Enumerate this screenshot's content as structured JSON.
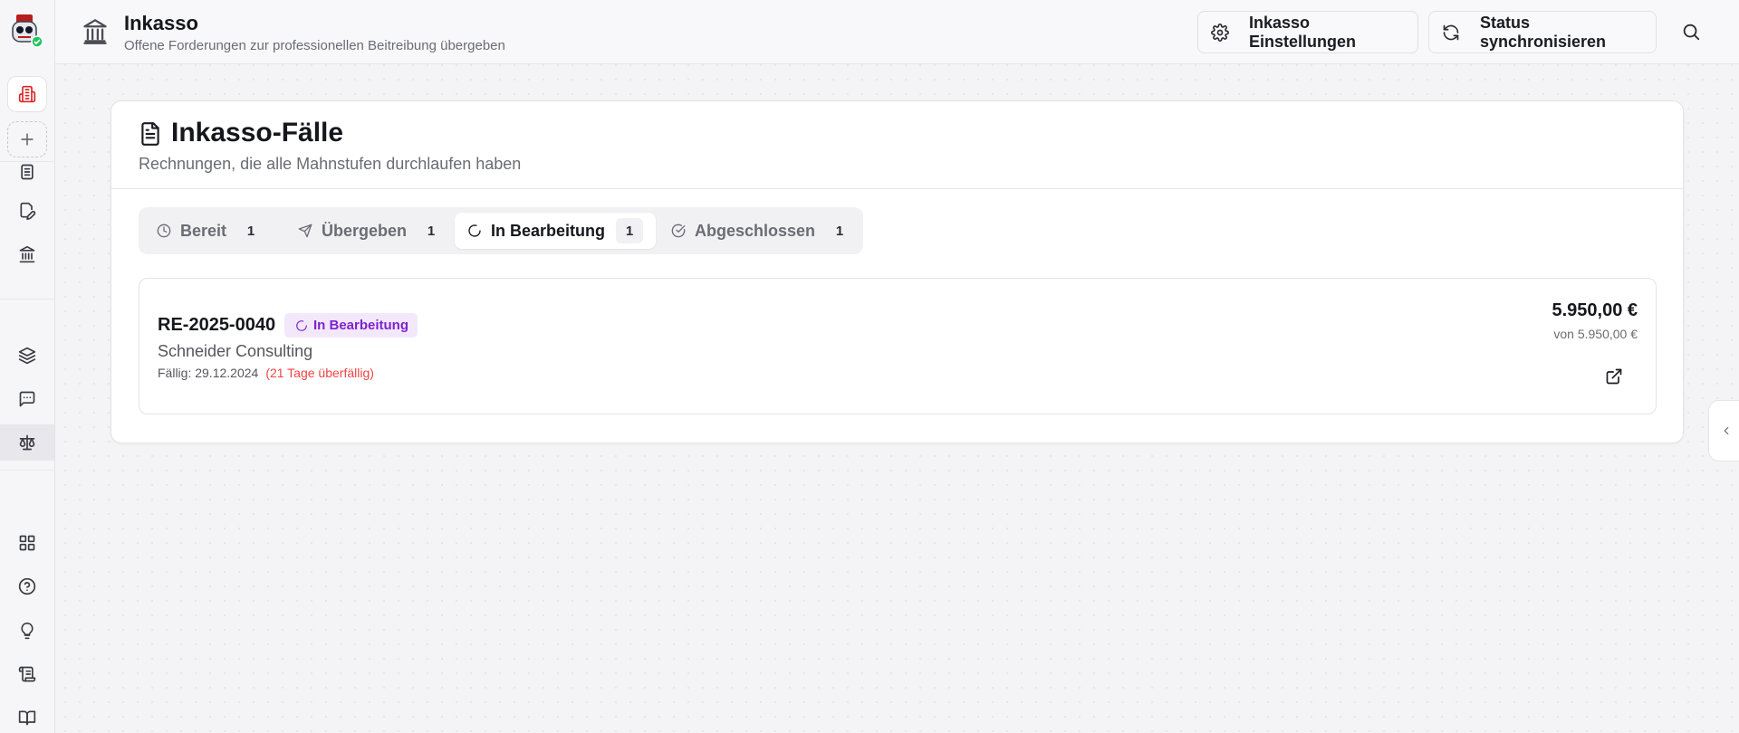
{
  "header": {
    "title": "Inkasso",
    "subtitle": "Offene Forderungen zur professionellen Beitreibung übergeben",
    "settings_label": "Inkasso Einstellungen",
    "sync_label": "Status synchronisieren"
  },
  "sidebar": {
    "items": [
      {
        "icon": "building-icon"
      },
      {
        "icon": "plus-icon"
      },
      {
        "icon": "document-icon"
      },
      {
        "icon": "edit-icon"
      },
      {
        "icon": "bank-icon"
      },
      {
        "icon": "layers-icon"
      },
      {
        "icon": "message-icon"
      },
      {
        "icon": "scale-icon",
        "active": true
      },
      {
        "icon": "grid-icon"
      },
      {
        "icon": "help-icon"
      },
      {
        "icon": "lightbulb-icon"
      },
      {
        "icon": "scroll-icon"
      },
      {
        "icon": "book-icon"
      }
    ]
  },
  "card": {
    "title": "Inkasso-Fälle",
    "subtitle": "Rechnungen, die alle Mahnstufen durchlaufen haben"
  },
  "tabs": [
    {
      "label": "Bereit",
      "count": "1",
      "icon": "clock-icon"
    },
    {
      "label": "Übergeben",
      "count": "1",
      "icon": "send-icon"
    },
    {
      "label": "In Bearbeitung",
      "count": "1",
      "icon": "loader-icon",
      "active": true
    },
    {
      "label": "Abgeschlossen",
      "count": "1",
      "icon": "check-circle-icon"
    }
  ],
  "case": {
    "invoice_id": "RE-2025-0040",
    "status": "In Bearbeitung",
    "customer": "Schneider Consulting",
    "due": "Fällig: 29.12.2024",
    "overdue": "(21 Tage überfällig)",
    "amount": "5.950,00 €",
    "amount_of": "von 5.950,00 €"
  },
  "colors": {
    "accent_red": "#dc2626",
    "badge_bg": "#f3e8fb",
    "badge_text": "#7e22ce",
    "overdue": "#ef4444"
  }
}
